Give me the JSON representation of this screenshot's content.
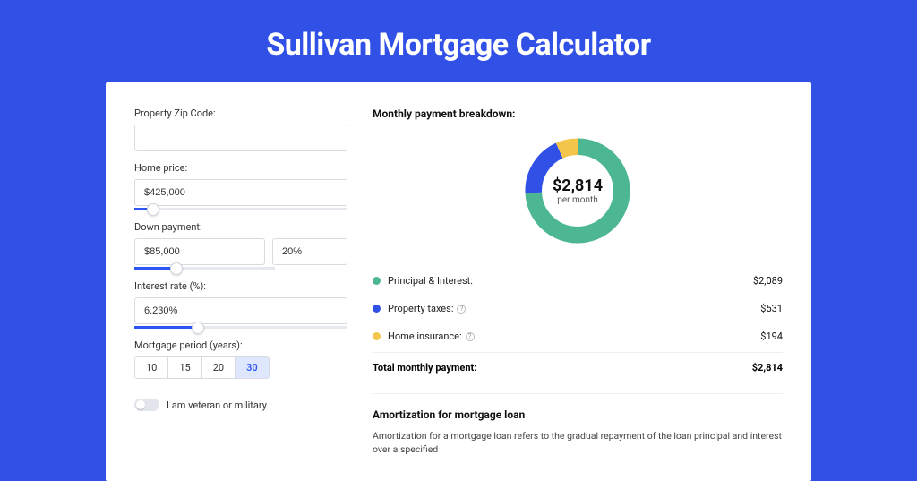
{
  "title": "Sullivan Mortgage Calculator",
  "form": {
    "zip_label": "Property Zip Code:",
    "zip_value": "",
    "home_price_label": "Home price:",
    "home_price_value": "$425,000",
    "down_payment_label": "Down payment:",
    "down_payment_value": "$85,000",
    "down_payment_pct": "20%",
    "interest_label": "Interest rate (%):",
    "interest_value": "6.230%",
    "period_label": "Mortgage period (years):",
    "periods": [
      "10",
      "15",
      "20",
      "30"
    ],
    "period_selected": "30",
    "veteran_label": "I am veteran or military"
  },
  "breakdown": {
    "title": "Monthly payment breakdown:",
    "center_value": "$2,814",
    "center_sub": "per month",
    "items": [
      {
        "label": "Principal & Interest:",
        "value": "$2,089",
        "color": "#4db692",
        "has_help": false,
        "fraction": 0.742
      },
      {
        "label": "Property taxes:",
        "value": "$531",
        "color": "#3151e6",
        "has_help": true,
        "fraction": 0.189
      },
      {
        "label": "Home insurance:",
        "value": "$194",
        "color": "#f3c54b",
        "has_help": true,
        "fraction": 0.069
      }
    ],
    "total_label": "Total monthly payment:",
    "total_value": "$2,814"
  },
  "amortization": {
    "title": "Amortization for mortgage loan",
    "text": "Amortization for a mortgage loan refers to the gradual repayment of the loan principal and interest over a specified"
  },
  "sliders": {
    "home_price_pct": 9,
    "down_payment_pct": 20,
    "interest_pct": 30
  }
}
